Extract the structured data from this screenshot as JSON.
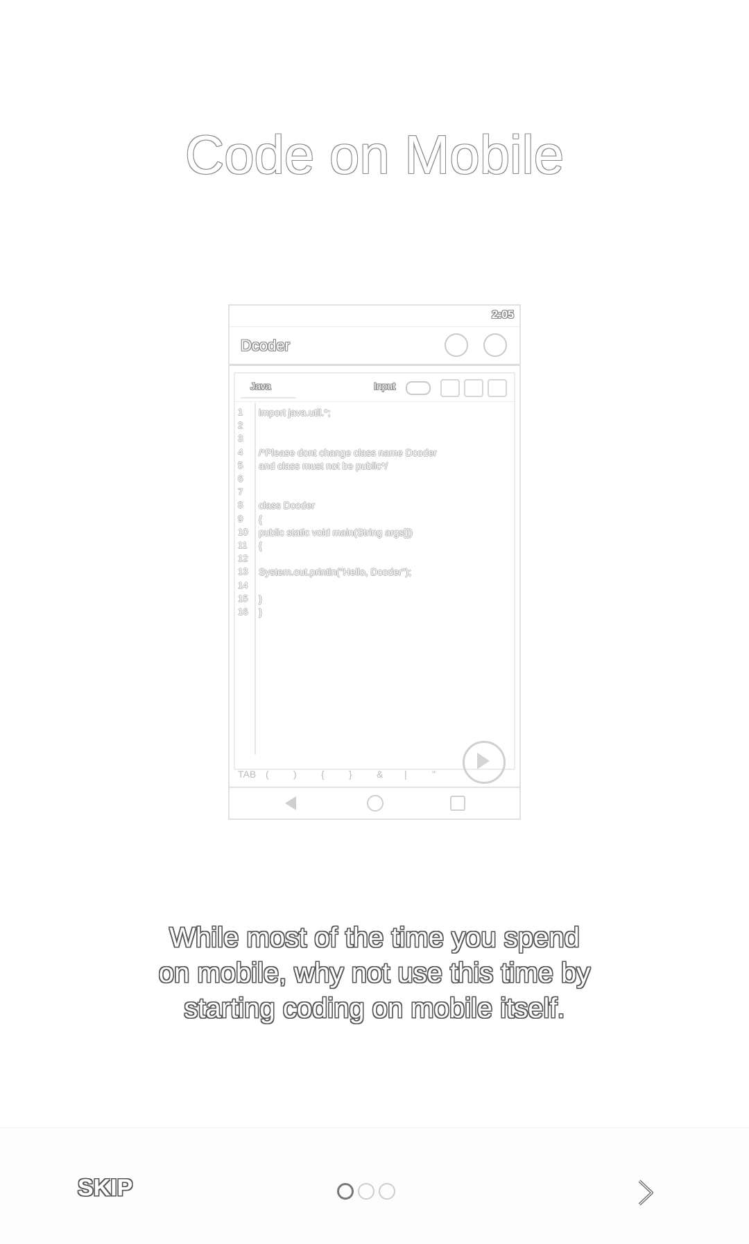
{
  "title": "Code on Mobile",
  "description_lines": [
    "While most of the time you spend",
    "on mobile, why not use this time by",
    "starting coding on mobile itself."
  ],
  "bottom_bar": {
    "skip_label": "SKIP",
    "page_indicator": {
      "total": 3,
      "active_index": 0
    },
    "next_icon": "chevron-right-icon"
  },
  "preview": {
    "status_bar": "2:05",
    "app_title": "Dcoder",
    "tab_label": "Java",
    "input_label": "Input",
    "line_numbers": [
      "1",
      "2",
      "3",
      "4",
      "5",
      "6",
      "7",
      "8",
      "9",
      "10",
      "11",
      "12",
      "13",
      "14",
      "15",
      "16"
    ],
    "code_lines": [
      "import java.util.*;",
      "",
      "",
      "/*Please dont change class name Dcoder",
      "and class must not be public*/",
      "",
      "",
      "class Dcoder",
      "{",
      "public static void main(String args[])",
      "{",
      "",
      "System.out.println(\"Hello, Dcoder\");",
      "",
      "}",
      "}"
    ],
    "keys": [
      "TAB",
      "(",
      ")",
      "{",
      "}",
      "&",
      "|",
      "\""
    ]
  }
}
